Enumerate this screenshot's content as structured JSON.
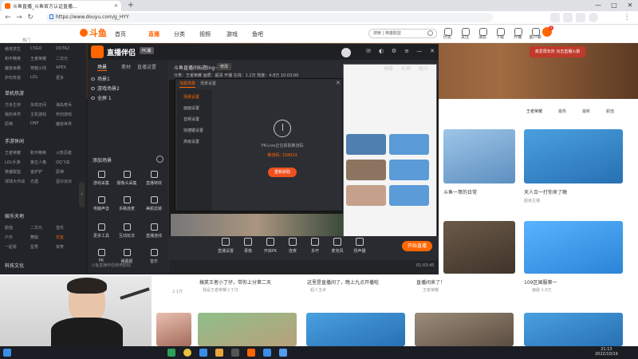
{
  "browser": {
    "tab_title": "斗鱼直播_斗鱼官方认证直播...",
    "url": "https://www.douyu.com/g_HYY",
    "new_tab": "+",
    "window_controls": [
      "—",
      "□",
      "✕"
    ]
  },
  "douyu": {
    "logo": "斗鱼",
    "nav": [
      "首页",
      "直播",
      "分类",
      "视频",
      "游戏",
      "鱼吧"
    ],
    "search_placeholder": "搜索 | 英雄联盟",
    "header_icons": [
      "历史",
      "关注",
      "消息",
      "下载",
      "开播",
      "客户端",
      "任务"
    ],
    "badge": "1",
    "banner_ad": "真爱周年庆 点击直播火箭"
  },
  "sidebar": {
    "top_label": "热门",
    "sections": [
      {
        "title": "",
        "items": [
          "绝地求生",
          "CSGO",
          "DOTA2",
          "和平精英",
          "王者荣耀",
          "二次元",
          "魔兽争霸",
          "穿越火线",
          "APEX",
          "炉石传说",
          "LOL",
          "更多"
        ]
      },
      {
        "title": "单机热游",
        "items": [
          "方舟生存",
          "永劫无间",
          "海岛奇兵",
          "我的世界",
          "主机游戏",
          "怀旧游戏",
          "原神",
          "DNF",
          "魔兽世界"
        ]
      },
      {
        "title": "手游休闲",
        "items": [
          "王者荣耀",
          "和平精英",
          "火影忍者",
          "LOL手游",
          "第五人格",
          "QQ飞车",
          "英雄联盟",
          "金铲铲",
          "原神",
          "球球大作战",
          "光遇",
          "蛋仔派对"
        ]
      },
      {
        "title": "娱乐天地",
        "items": [
          "颜值",
          "二次元",
          "音乐",
          "户外",
          "舞蹈",
          "交友",
          "一起看",
          "星秀",
          "体育"
        ]
      },
      {
        "title": "科技文化",
        "items": []
      }
    ]
  },
  "zhiboban": {
    "name": "直播伴侣",
    "version": "PC版",
    "left_tabs": [
      "场景",
      "素材",
      "直播设置"
    ],
    "scenes": [
      "场景1",
      "游戏场景2",
      "全屏 1"
    ],
    "add_scene": "添加场景",
    "tools": [
      "游戏采集",
      "摄像头采集",
      "直播特效",
      "电脑声音",
      "多路连麦",
      "美颜滤镜",
      "更多工具",
      "互动玩法",
      "直播连线",
      "PK",
      "弹幕姬",
      "音乐"
    ],
    "bottom_link": "斗鱼直播伴侣使用帮助",
    "room_title": "斗鱼直播间标题ing~",
    "modify": "修改",
    "tags_line": "分类：王者荣耀   画质：超清   开播   在线：1.2万   热度：4.8万   10:03:00",
    "right_tabs": [
      "弹幕",
      "礼物",
      "观众"
    ],
    "controls": [
      "直播设置",
      "录像",
      "开启PK",
      "连麦",
      "多开",
      "麦克风",
      "扬声器"
    ],
    "go_live": "开始直播",
    "time": "01:03:45"
  },
  "dialog": {
    "tabs": [
      "加载场景",
      "场景设置"
    ],
    "menu": [
      "场景设置",
      "画面设置",
      "音频设置",
      "快捷键设置",
      "高级设置"
    ],
    "message": "PK-Live正在获取推流码",
    "code": "推流码: 158014",
    "button": "重新获取",
    "close": "✕"
  },
  "content": {
    "categories": [
      "王者荣耀",
      "最热",
      "最新",
      "附近",
      "颜值"
    ],
    "cards_mid": [
      {
        "title": "天人合一打你来了嗷",
        "sub": "超级主播"
      },
      {
        "title": "斗鱼一哥的日常",
        "sub": "热度 3.2万"
      }
    ],
    "cards_bottom": [
      {
        "title": "",
        "sub": "2.1万"
      },
      {
        "title": "搞笑王者小丁仔，带你上分第二天",
        "sub": "我是王者荣耀小丁仔"
      },
      {
        "title": "这里是直播间了，晚上九点开播啦",
        "sub": "超人玉米"
      },
      {
        "title": "直播间来了！",
        "sub": "王者荣耀"
      },
      {
        "title": "109区国服第一",
        "sub": "鹿晨 1.6万"
      }
    ]
  },
  "taskbar": {
    "time": "21:13",
    "date": "2022/10/19"
  }
}
